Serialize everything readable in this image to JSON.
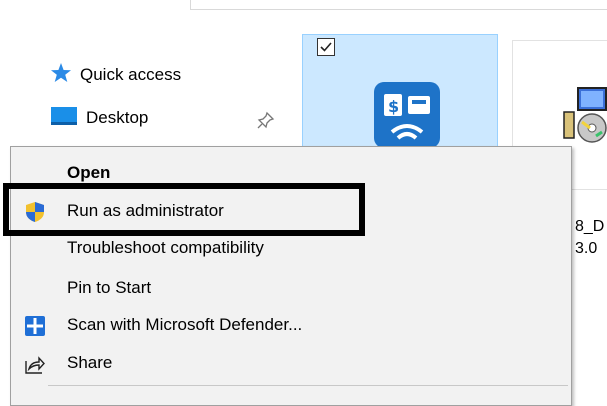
{
  "nav": {
    "quick_access": "Quick access",
    "desktop": "Desktop"
  },
  "file": {
    "name_line1": "8_D",
    "name_line2": "3.0"
  },
  "menu": {
    "items": [
      {
        "label": "Open",
        "icon": "none"
      },
      {
        "label": "Run as administrator",
        "icon": "uac-shield-icon"
      },
      {
        "label": "Troubleshoot compatibility",
        "icon": "none"
      },
      {
        "label": "Pin to Start",
        "icon": "none"
      },
      {
        "label": "Scan with Microsoft Defender...",
        "icon": "defender-icon"
      },
      {
        "label": "Share",
        "icon": "share-icon"
      }
    ]
  },
  "colors": {
    "selection_bg": "#cce8ff",
    "menu_bg": "#f2f2f2",
    "highlight_border": "#000000",
    "accent_blue": "#1e73c8"
  }
}
